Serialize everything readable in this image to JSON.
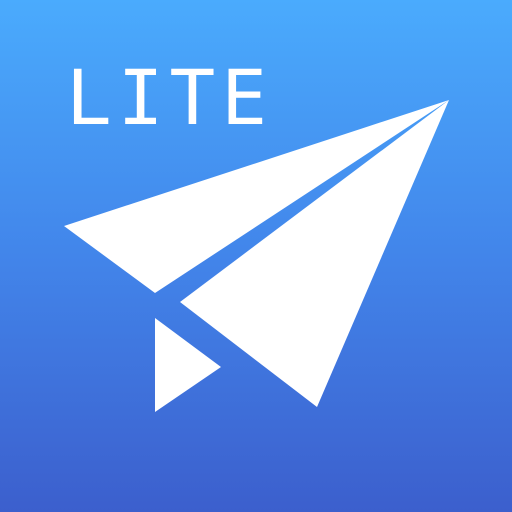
{
  "icon": {
    "badge_label": "LITE",
    "glyph": "paper-plane-icon",
    "colors": {
      "gradient_top": "#4aabfd",
      "gradient_bottom": "#3c5fcd",
      "foreground": "#ffffff"
    }
  }
}
